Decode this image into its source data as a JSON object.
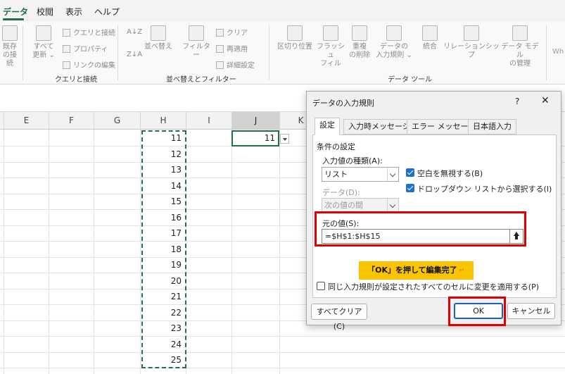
{
  "tabs": [
    "データ",
    "校閲",
    "表示",
    "ヘルプ"
  ],
  "ribbon": {
    "existing_conn": [
      "既存",
      "の接続"
    ],
    "refresh_all": [
      "すべて",
      "更新 ⌄"
    ],
    "query_connections": "クエリと接続",
    "properties": "プロパティ",
    "edit_links": "リンクの編集",
    "group_query": "クエリと接続",
    "sort_asc": "A↓Z",
    "sort_desc": "Z↓A",
    "sort": "並べ替え",
    "filter": "フィルター",
    "clear": "クリア",
    "reapply": "再適用",
    "advanced": "詳細設定",
    "group_sort": "並べ替えとフィルター",
    "text_to_columns": "区切り位置",
    "flash_fill": [
      "フラッシュ",
      "フィル"
    ],
    "remove_duplicates": [
      "重複",
      "の削除"
    ],
    "data_validation": [
      "データの",
      "入力規則 ⌄"
    ],
    "consolidate": "統合",
    "relationships": "リレーションシップ",
    "data_model": [
      "データ モデル",
      "の管理"
    ],
    "wh": "Wh",
    "group_tools": "データ ツール"
  },
  "sheet": {
    "columns": [
      "E",
      "F",
      "G",
      "H",
      "I",
      "J",
      "K"
    ],
    "h_values": [
      "11",
      "12",
      "13",
      "14",
      "15",
      "16",
      "17",
      "18",
      "19",
      "20",
      "21",
      "22",
      "23",
      "24",
      "25"
    ],
    "j_value": "11"
  },
  "dialog": {
    "title": "データの入力規則",
    "help": "?",
    "close": "✕",
    "tabs": [
      "設定",
      "入力時メッセージ",
      "エラー メッセージ",
      "日本語入力"
    ],
    "section": "条件の設定",
    "allow_label": "入力値の種類(A):",
    "allow_value": "リスト",
    "ignore_blank": "空白を無視する(B)",
    "dropdown": "ドロップダウン リストから選択する(I)",
    "data_label": "データ(D):",
    "data_value": "次の値の間",
    "source_label": "元の値(S):",
    "source_value": "=$H$1:$H$15",
    "apply_all": "同じ入力規則が設定されたすべてのセルに変更を適用する(P)",
    "clear_all": "すべてクリア(C)",
    "ok": "OK",
    "cancel": "キャンセル"
  },
  "callout": "「OK」を押して編集完了",
  "callout_mark": "↵",
  "colors": {
    "accent": "#1e6e42",
    "highlight": "#e00000",
    "callout": "#fbc400",
    "checkbox": "#1f6fd0"
  }
}
